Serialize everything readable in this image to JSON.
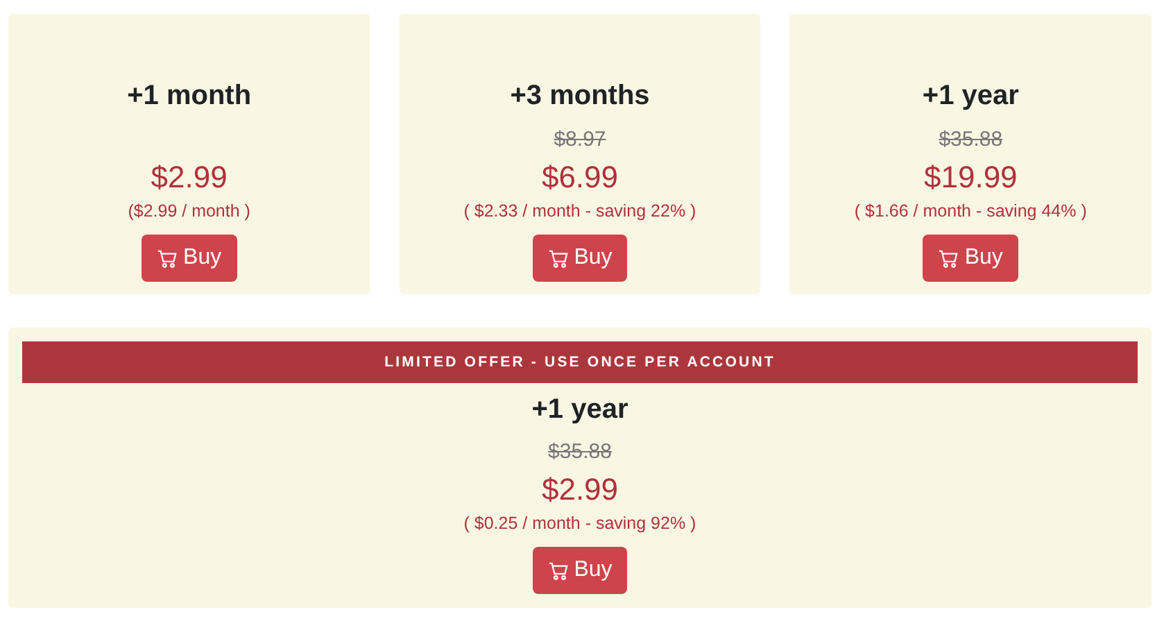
{
  "plans": [
    {
      "title": "+1 month",
      "price": "$2.99",
      "per_month": "($2.99 / month )",
      "button": "Buy"
    },
    {
      "title": "+3 months",
      "old_price": "$8.97",
      "price": "$6.99",
      "per_month": "( $2.33 / month - saving 22% )",
      "button": "Buy"
    },
    {
      "title": "+1 year",
      "old_price": "$35.88",
      "price": "$19.99",
      "per_month": "( $1.66 / month - saving 44% )",
      "button": "Buy"
    }
  ],
  "offer": {
    "banner": "LIMITED OFFER - USE ONCE PER ACCOUNT",
    "title": "+1 year",
    "old_price": "$35.88",
    "price": "$2.99",
    "per_month": "( $0.25 / month - saving 92% )",
    "button": "Buy"
  }
}
